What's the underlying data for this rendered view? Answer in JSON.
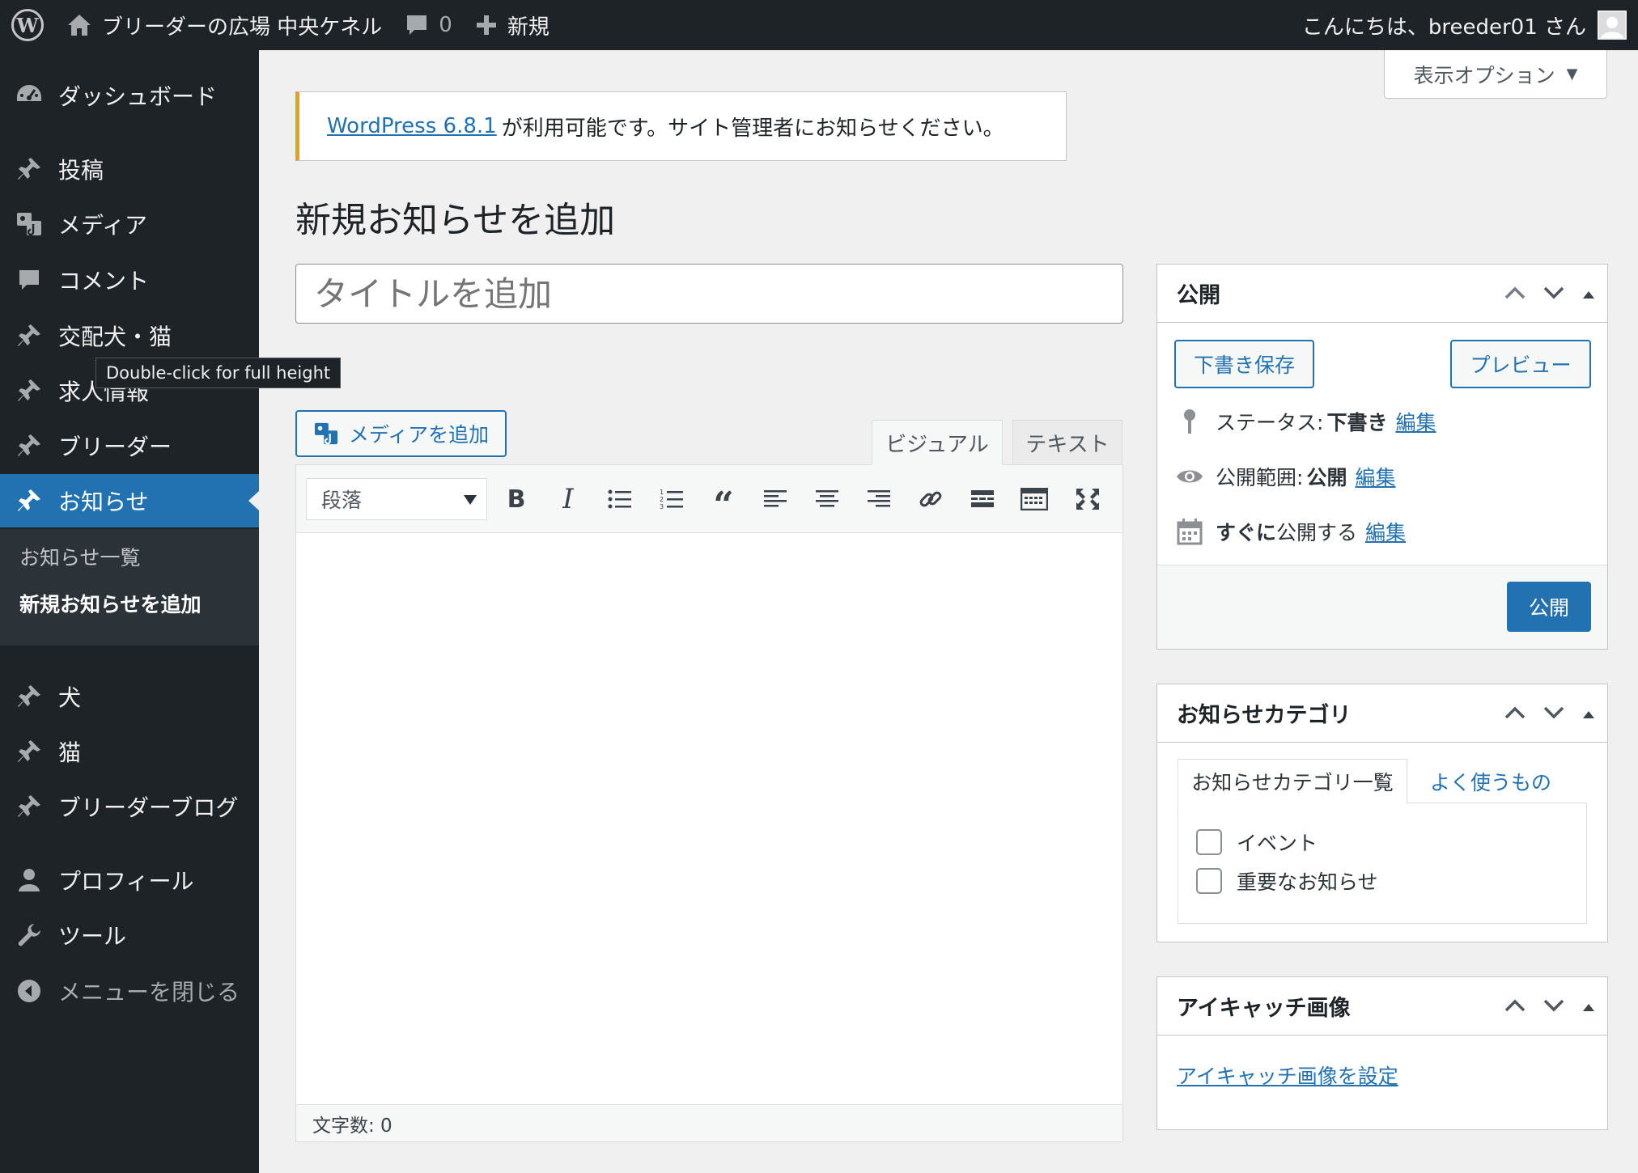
{
  "adminbar": {
    "site_name": "ブリーダーの広場 中央ケネル",
    "comment_count": "0",
    "new_label": "新規",
    "greeting": "こんにちは、breeder01 さん"
  },
  "sidebar": {
    "items": [
      {
        "label": "ダッシュボード",
        "icon": "dashboard-icon"
      },
      {
        "label": "投稿",
        "icon": "pin-icon"
      },
      {
        "label": "メディア",
        "icon": "media-icon"
      },
      {
        "label": "コメント",
        "icon": "comment-icon"
      },
      {
        "label": "交配犬・猫",
        "icon": "pin-icon"
      },
      {
        "label": "求人情報",
        "icon": "pin-icon"
      },
      {
        "label": "ブリーダー",
        "icon": "pin-icon"
      },
      {
        "label": "お知らせ",
        "icon": "pin-icon"
      },
      {
        "label": "犬",
        "icon": "pin-icon"
      },
      {
        "label": "猫",
        "icon": "pin-icon"
      },
      {
        "label": "ブリーダーブログ",
        "icon": "pin-icon"
      },
      {
        "label": "プロフィール",
        "icon": "user-icon"
      },
      {
        "label": "ツール",
        "icon": "wrench-icon"
      },
      {
        "label": "メニューを閉じる",
        "icon": "collapse-icon"
      }
    ],
    "submenu": [
      "お知らせ一覧",
      "新規お知らせを追加"
    ]
  },
  "tooltip": "Double-click for full height",
  "screen_options": "表示オプション",
  "notice": {
    "link": "WordPress 6.8.1",
    "text": "が利用可能です。サイト管理者にお知らせください。"
  },
  "page_title": "新規お知らせを追加",
  "title_placeholder": "タイトルを追加",
  "editor": {
    "add_media": "メディアを追加",
    "tab_visual": "ビジュアル",
    "tab_text": "テキスト",
    "format": "段落",
    "word_count": "文字数: 0"
  },
  "publish_box": {
    "title": "公開",
    "save_draft": "下書き保存",
    "preview": "プレビュー",
    "status_label": "ステータス:",
    "status_value": "下書き",
    "visibility_label": "公開範囲:",
    "visibility_value": "公開",
    "schedule_bold": "すぐに",
    "schedule_rest": "公開する",
    "edit": "編集",
    "publish": "公開"
  },
  "category_box": {
    "title": "お知らせカテゴリ",
    "tab_all": "お知らせカテゴリ一覧",
    "tab_popular": "よく使うもの",
    "categories": [
      "イベント",
      "重要なお知らせ"
    ]
  },
  "thumbnail_box": {
    "title": "アイキャッチ画像",
    "set_link": "アイキャッチ画像を設定"
  },
  "colors": {
    "admin_bg": "#1d2327",
    "accent": "#2271b1",
    "notice_warning": "#dba617"
  }
}
